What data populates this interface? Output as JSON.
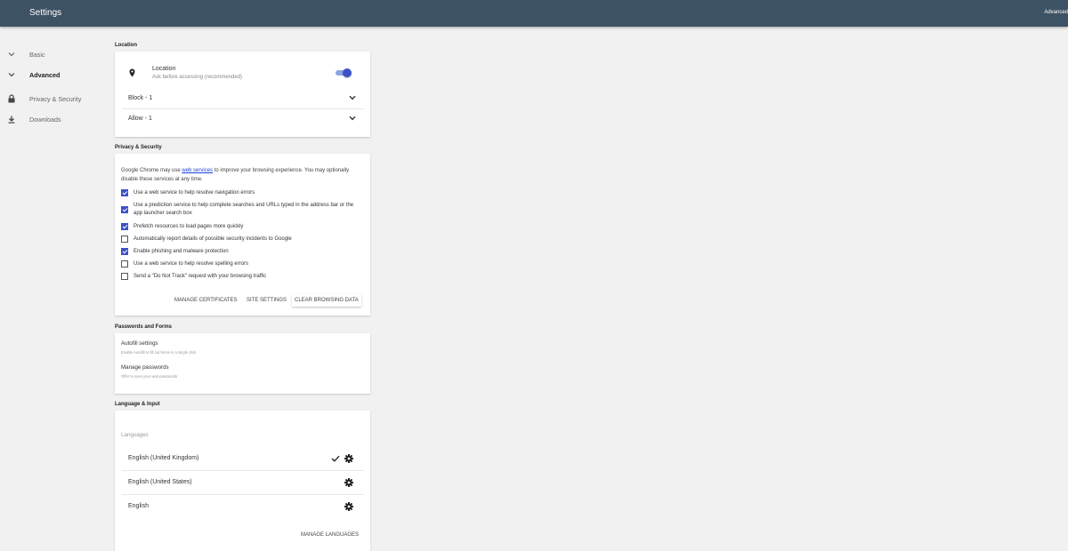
{
  "header": {
    "title": "Settings",
    "right_label": "Advanced"
  },
  "sidebar": {
    "items": [
      {
        "label": "Basic",
        "icon": "chevron-down-icon"
      },
      {
        "label": "Advanced",
        "icon": "chevron-down-icon"
      },
      {
        "label": "Privacy & Security",
        "icon": "lock-icon"
      },
      {
        "label": "Downloads",
        "icon": "download-icon"
      }
    ]
  },
  "location": {
    "section_title": "Location",
    "title": "Location",
    "subtitle": "Ask before accessing (recommended)",
    "toggle_on": true,
    "block_label": "Block - 1",
    "allow_label": "Allow - 1"
  },
  "privacy": {
    "section_title": "Privacy & Security",
    "intro_before": "Google Chrome may use ",
    "intro_link": "web services",
    "intro_after": " to improve your browsing experience. You may optionally disable these services at any time.",
    "options": [
      {
        "label": "Use a web service to help resolve navigation errors",
        "checked": true
      },
      {
        "label": "Use a prediction service to help complete searches and URLs typed in the address bar or the app launcher search box",
        "checked": true
      },
      {
        "label": "Prefetch resources to load pages more quickly",
        "checked": true
      },
      {
        "label": "Automatically report details of possible security incidents to Google",
        "checked": false
      },
      {
        "label": "Enable phishing and malware protection",
        "checked": true
      },
      {
        "label": "Use a web service to help resolve spelling errors",
        "checked": false
      },
      {
        "label": "Send a \"Do Not Track\" request with your browsing traffic",
        "checked": false
      }
    ],
    "buttons": {
      "manage_certificates": "MANAGE CERTIFICATES",
      "site_settings": "SITE SETTINGS",
      "clear_browsing_data": "CLEAR BROWSING DATA"
    }
  },
  "passwords": {
    "section_title": "Passwords and Forms",
    "autofill_title": "Autofill settings",
    "autofill_sub": "Enable Autofill to fill out forms in a single click",
    "manage_title": "Manage passwords",
    "manage_sub": "Offer to save your web passwords"
  },
  "language": {
    "section_title": "Language & Input",
    "languages_heading": "Languages",
    "items": [
      {
        "label": "English (United Kingdom)",
        "selected": true
      },
      {
        "label": "English (United States)",
        "selected": false
      },
      {
        "label": "English",
        "selected": false
      }
    ],
    "manage_button": "MANAGE LANGUAGES"
  },
  "colors": {
    "header_bg": "#3e5265",
    "accent": "#3c50c8",
    "link": "#1a3fd9"
  }
}
